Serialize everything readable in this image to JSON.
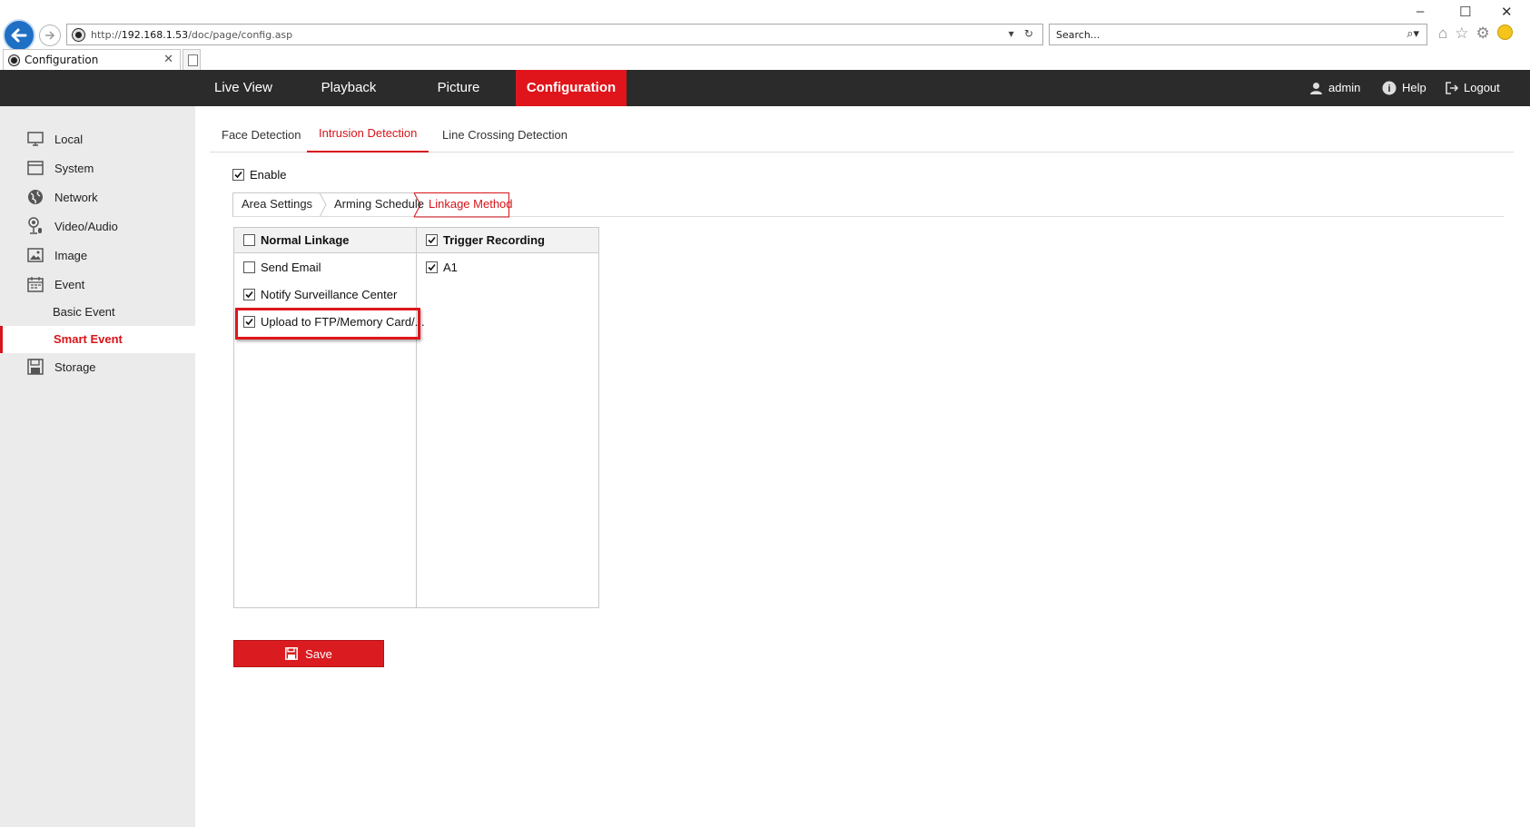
{
  "browser": {
    "url_prefix": "http://",
    "url_host": "192.168.1.53",
    "url_path": "/doc/page/config.asp",
    "search_placeholder": "Search...",
    "tab_title": "Configuration"
  },
  "topnav": {
    "items": [
      "Live View",
      "Playback",
      "Picture",
      "Configuration"
    ],
    "active": "Configuration",
    "user": "admin",
    "help": "Help",
    "logout": "Logout"
  },
  "sidebar": {
    "items": {
      "local": "Local",
      "system": "System",
      "network": "Network",
      "video_audio": "Video/Audio",
      "image": "Image",
      "event": "Event",
      "basic_event": "Basic Event",
      "smart_event": "Smart Event",
      "storage": "Storage"
    },
    "active": "Smart Event"
  },
  "subtabs": {
    "items": [
      "Face Detection",
      "Intrusion Detection",
      "Line Crossing Detection"
    ],
    "active": "Intrusion Detection"
  },
  "enable": {
    "label": "Enable",
    "checked": true
  },
  "steps": {
    "items": [
      "Area Settings",
      "Arming Schedule",
      "Linkage Method"
    ],
    "active": "Linkage Method"
  },
  "linkage": {
    "normal_header": {
      "label": "Normal Linkage",
      "checked": false
    },
    "normal_items": [
      {
        "label": "Send Email",
        "checked": false
      },
      {
        "label": "Notify Surveillance Center",
        "checked": true
      },
      {
        "label": "Upload to FTP/Memory Card/...",
        "checked": true
      }
    ],
    "trigger_header": {
      "label": "Trigger Recording",
      "checked": true
    },
    "trigger_items": [
      {
        "label": "A1",
        "checked": true
      }
    ]
  },
  "save_label": "Save",
  "colors": {
    "accent": "#e0151b",
    "nav_bg": "#2b2b2b",
    "sidebar_bg": "#ebebeb"
  }
}
